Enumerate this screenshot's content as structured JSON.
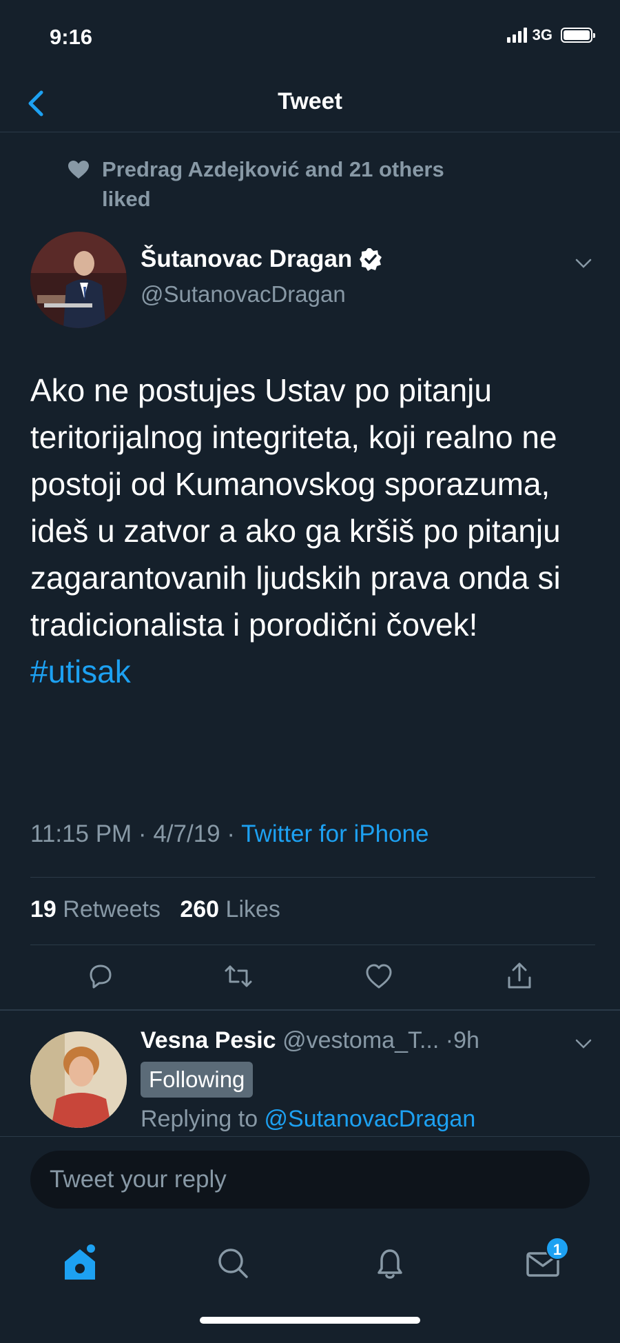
{
  "status_bar": {
    "time": "9:16",
    "network": "3G"
  },
  "nav": {
    "title": "Tweet"
  },
  "social_context": {
    "text": "Predrag Azdejković and 21 others liked"
  },
  "tweet": {
    "author_name": "Šutanovac Dragan",
    "author_handle": "@SutanovacDragan",
    "text": "Ako ne postujes Ustav po pitanju teritorijalnog integriteta, koji realno ne postoji od Kumanovskog sporazuma, ideš u zatvor a ako ga kršiš po pitanju zagarantovanih ljudskih prava onda si tradicionalista i porodični čovek!",
    "hashtag": "#utisak",
    "timestamp": "11:15 PM · 4/7/19 · ",
    "source": "Twitter for iPhone",
    "retweet_count": "19",
    "retweet_label": " Retweets",
    "like_count": "260",
    "like_label": " Likes"
  },
  "reply": {
    "author_name": "Vesna Pesic",
    "author_handle": "@vestoma_T...",
    "time": "·9h",
    "following_label": "Following",
    "replying_prefix": "Replying to ",
    "replying_to": "@SutanovacDragan"
  },
  "compose": {
    "placeholder": "Tweet your reply"
  },
  "tab_bar": {
    "notification_badge": "1"
  },
  "colors": {
    "background": "#15202b",
    "accent": "#1da1f2",
    "muted": "#8899a6"
  },
  "icons": [
    "back-icon",
    "heart-icon",
    "verified-icon",
    "chevron-down-icon",
    "reply-icon",
    "retweet-icon",
    "like-icon",
    "share-icon",
    "home-icon",
    "search-icon",
    "notifications-icon",
    "messages-icon"
  ]
}
